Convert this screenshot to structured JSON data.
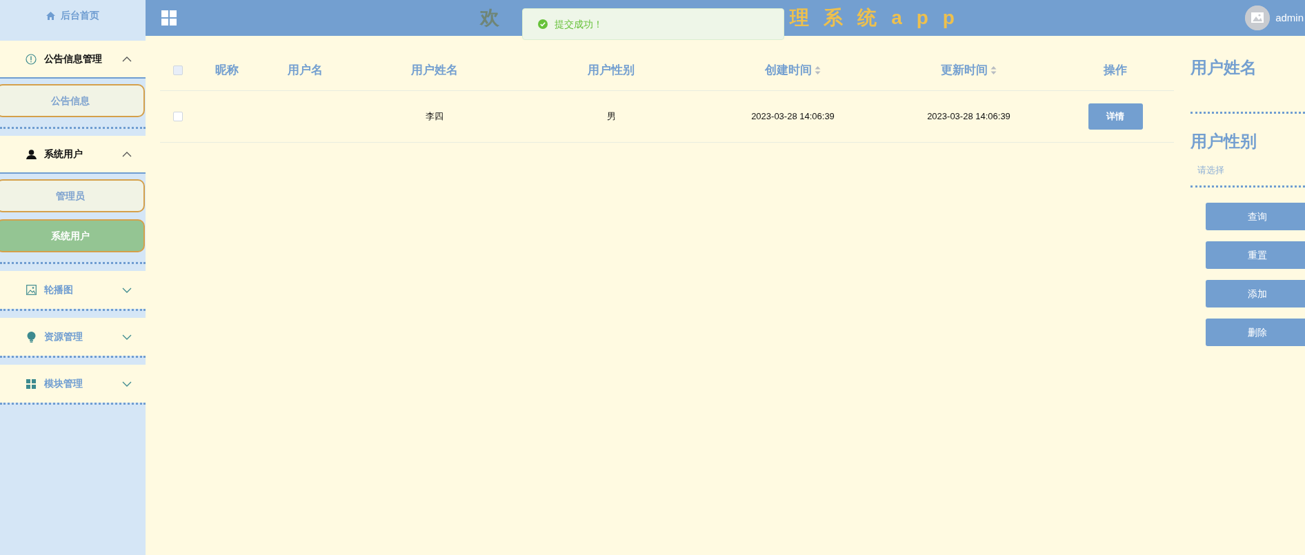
{
  "header": {
    "title_start": "欢",
    "title_end": "理系统app",
    "user": "admin"
  },
  "toast": {
    "text": "提交成功！"
  },
  "sidebar": {
    "items": [
      {
        "kind": "link",
        "label": "后台首页"
      },
      {
        "kind": "group",
        "label": "公告信息管理",
        "expanded": true,
        "children": [
          {
            "label": "公告信息",
            "selected": false
          }
        ]
      },
      {
        "kind": "group",
        "label": "系统用户",
        "expanded": true,
        "children": [
          {
            "label": "管理员",
            "selected": false
          },
          {
            "label": "系统用户",
            "selected": true
          }
        ]
      },
      {
        "kind": "group",
        "label": "轮播图",
        "expanded": false
      },
      {
        "kind": "group",
        "label": "资源管理",
        "expanded": false
      },
      {
        "kind": "group",
        "label": "模块管理",
        "expanded": false
      }
    ]
  },
  "table": {
    "select_all_checked": false,
    "columns": [
      {
        "label": "昵称",
        "sortable": false
      },
      {
        "label": "用户名",
        "sortable": false
      },
      {
        "label": "用户姓名",
        "sortable": false
      },
      {
        "label": "用户性别",
        "sortable": false
      },
      {
        "label": "创建时间",
        "sortable": true
      },
      {
        "label": "更新时间",
        "sortable": true
      },
      {
        "label": "操作",
        "sortable": false
      }
    ],
    "rows": [
      {
        "checked": false,
        "cells": [
          "",
          "",
          "李四",
          "男",
          "2023-03-28 14:06:39",
          "2023-03-28 14:06:39"
        ],
        "action": "详情"
      }
    ]
  },
  "search": {
    "fields": [
      {
        "label": "用户姓名"
      },
      {
        "label": "用户性别",
        "placeholder": "请选择"
      }
    ],
    "buttons": [
      "查询",
      "重置",
      "添加",
      "删除"
    ]
  }
}
